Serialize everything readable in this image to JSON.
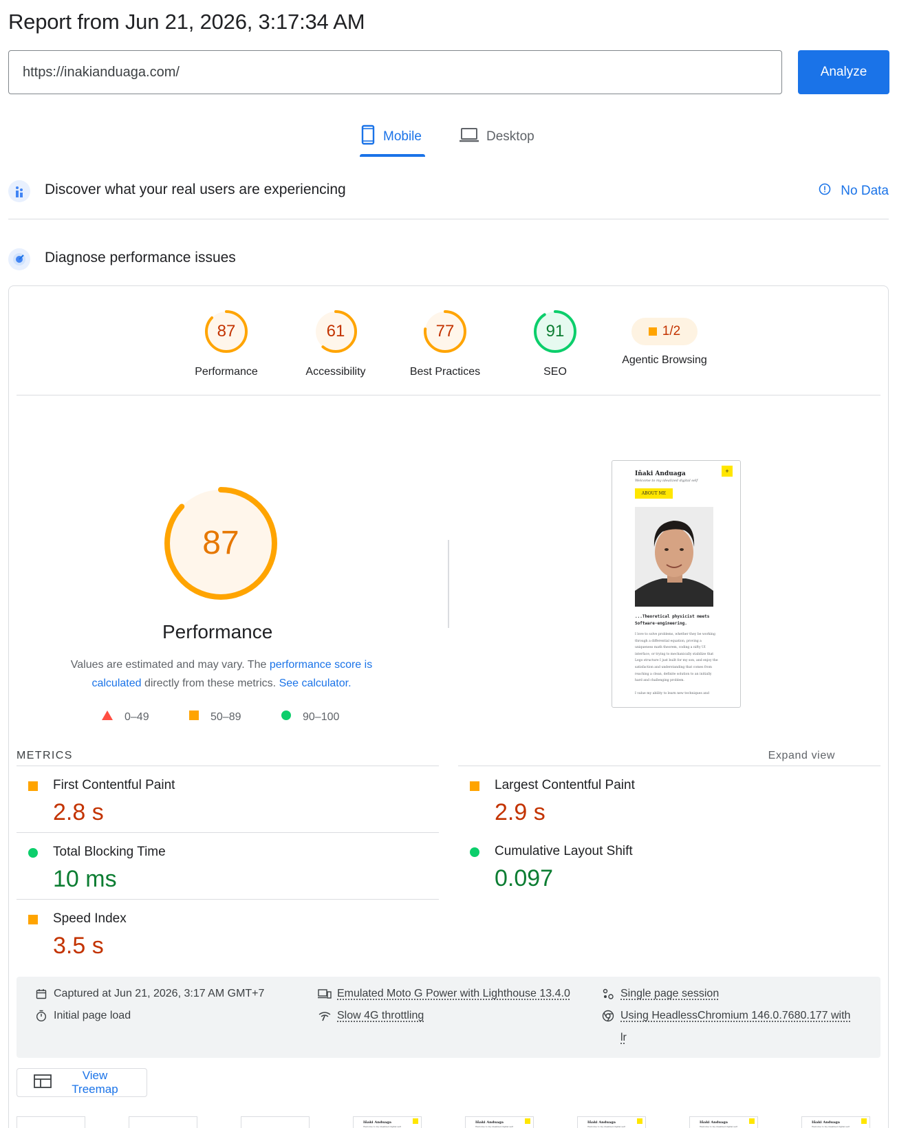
{
  "header": {
    "title": "Report from Jun 21, 2026, 3:17:34 AM"
  },
  "search": {
    "url_value": "https://inakianduaga.com/",
    "analyze_label": "Analyze"
  },
  "tabs": [
    {
      "label": "Mobile",
      "active": true,
      "icon": "smartphone-icon"
    },
    {
      "label": "Desktop",
      "active": false,
      "icon": "laptop-icon"
    }
  ],
  "field_data": {
    "heading": "Discover what your real users are experiencing",
    "status": "No Data"
  },
  "diagnose": {
    "heading": "Diagnose performance issues"
  },
  "scores": [
    {
      "label": "Performance",
      "value": "87",
      "score": 87,
      "rating": "average"
    },
    {
      "label": "Accessibility",
      "value": "61",
      "score": 61,
      "rating": "average"
    },
    {
      "label": "Best Practices",
      "value": "77",
      "score": 77,
      "rating": "average"
    },
    {
      "label": "SEO",
      "value": "91",
      "score": 91,
      "rating": "good"
    },
    {
      "label": "Agentic Browsing",
      "value": "1/2",
      "rating": "average"
    }
  ],
  "performance": {
    "score": "87",
    "title": "Performance",
    "desc_prefix": "Values are estimated and may vary. The ",
    "desc_link": "performance score is calculated",
    "desc_middle": " directly from these metrics. ",
    "desc_calc": "See calculator.",
    "legend": {
      "poor": "0–49",
      "average": "50–89",
      "good": "90–100"
    }
  },
  "screenshot": {
    "name": "Iñaki Anduaga",
    "tagline": "Welcome to my idealized digital self",
    "badge": "ABOUT ME",
    "headline_1": "...Theoretical physicist meets",
    "headline_2": "Software-engineering.",
    "body": "I love to solve problems, whether they be working through a differential equation, proving a uniqueness math theorem, coding a nifty UI interface, or trying to mechanically stabilize that Lego structure I just built for my son, and enjoy the satisfaction and understanding that comes from reaching a clean, definite solution to an initially hard and challenging problem.",
    "body_2": "I value my ability to learn new techniques and"
  },
  "metrics": {
    "label": "METRICS",
    "expand": "Expand view",
    "items": [
      {
        "name": "First Contentful Paint",
        "value": "2.8 s",
        "rating": "average"
      },
      {
        "name": "Largest Contentful Paint",
        "value": "2.9 s",
        "rating": "average"
      },
      {
        "name": "Total Blocking Time",
        "value": "10 ms",
        "rating": "good"
      },
      {
        "name": "Cumulative Layout Shift",
        "value": "0.097",
        "rating": "good"
      },
      {
        "name": "Speed Index",
        "value": "3.5 s",
        "rating": "average"
      }
    ]
  },
  "runtime": {
    "captured": "Captured at Jun 21, 2026, 3:17 AM GMT+7",
    "load": "Initial page load",
    "device": "Emulated Moto G Power with Lighthouse 13.4.0",
    "throttling": "Slow 4G throttling",
    "session": "Single page session",
    "browser": "Using HeadlessChromium 146.0.7680.177 with",
    "browser_2": "lr"
  },
  "treemap": {
    "label": "View Treemap"
  },
  "filmstrip": {
    "name": "Iñaki Anduaga",
    "tagline": "Welcome to my idealized digital self"
  },
  "colors": {
    "accent": "#1a73e8",
    "average": "#ffa400",
    "good": "#0cce6b",
    "poor": "#ff4e42",
    "avg_text": "#c33300",
    "good_text": "#0c7d32"
  }
}
